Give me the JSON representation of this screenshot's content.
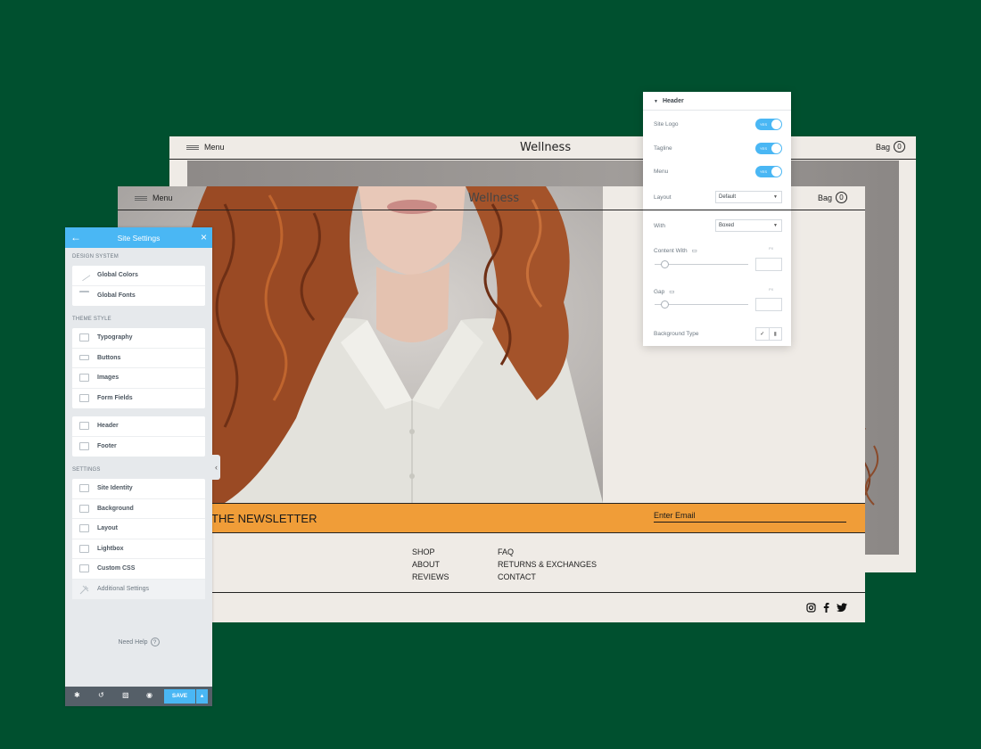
{
  "colors": {
    "background": "#00502f",
    "accent": "#4ab7f4",
    "newsletter": "#f09d38",
    "site_bg": "#efebe6"
  },
  "back_site": {
    "menu_label": "Menu",
    "brand": "Wellness",
    "bag_label": "Bag",
    "bag_count": "0"
  },
  "site": {
    "menu_label": "Menu",
    "brand": "Wellness",
    "bag_label": "Bag",
    "bag_count": "0",
    "newsletter": {
      "title": "THE NEWSLETTER",
      "email_placeholder": "Enter Email"
    },
    "footer": {
      "col1": [
        "SHOP",
        "ABOUT",
        "REVIEWS"
      ],
      "col2": [
        "FAQ",
        "RETURNS & EXCHANGES",
        "CONTACT"
      ]
    },
    "social_icons": [
      "instagram-icon",
      "facebook-icon",
      "twitter-icon"
    ]
  },
  "settings_panel": {
    "title": "Site Settings",
    "sections": [
      {
        "label": "DESIGN SYSTEM",
        "items": [
          {
            "label": "Global Colors",
            "icon": "brush-icon"
          },
          {
            "label": "Global Fonts",
            "icon": "text-icon"
          }
        ]
      },
      {
        "label": "THEME STYLE",
        "items": [
          {
            "label": "Typography",
            "icon": "heading-icon"
          },
          {
            "label": "Buttons",
            "icon": "button-icon"
          },
          {
            "label": "Images",
            "icon": "image-icon"
          },
          {
            "label": "Form Fields",
            "icon": "form-icon"
          }
        ]
      },
      {
        "label": "",
        "items": [
          {
            "label": "Header",
            "icon": "header-icon"
          },
          {
            "label": "Footer",
            "icon": "footer-icon"
          }
        ]
      },
      {
        "label": "SETTINGS",
        "items": [
          {
            "label": "Site Identity",
            "icon": "identity-icon"
          },
          {
            "label": "Background",
            "icon": "background-icon"
          },
          {
            "label": "Layout",
            "icon": "layout-icon"
          },
          {
            "label": "Lightbox",
            "icon": "lightbox-icon"
          },
          {
            "label": "Custom CSS",
            "icon": "code-icon"
          },
          {
            "label": "Additional Settings",
            "icon": "tools-icon"
          }
        ]
      }
    ],
    "help_label": "Need Help",
    "save_label": "SAVE"
  },
  "header_panel": {
    "title": "Header",
    "toggles": [
      {
        "label": "Site Logo",
        "state": "YES"
      },
      {
        "label": "Tagline",
        "state": "YES"
      },
      {
        "label": "Menu",
        "state": "YES"
      }
    ],
    "layout": {
      "label": "Layout",
      "value": "Default"
    },
    "width": {
      "label": "With",
      "value": "Boxed"
    },
    "content_width": {
      "label": "Content With",
      "unit": "PX"
    },
    "gap": {
      "label": "Gap",
      "unit": "PX"
    },
    "background_type": {
      "label": "Background Type"
    }
  }
}
